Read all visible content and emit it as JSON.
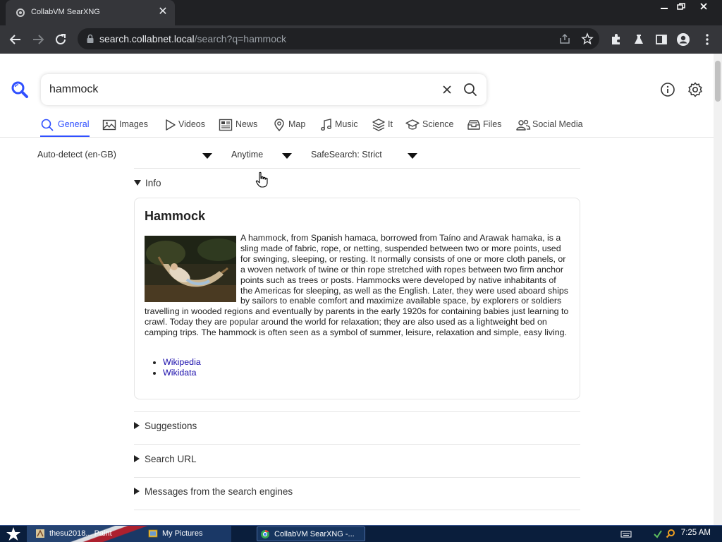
{
  "browser": {
    "tab_title": "CollabVM SearXNG",
    "url_host": "search.collabnet.local",
    "url_path": "/search?q=hammock"
  },
  "search": {
    "query": "hammock"
  },
  "categories": [
    {
      "label": "General",
      "icon": "search-icon",
      "active": true
    },
    {
      "label": "Images",
      "icon": "image-icon"
    },
    {
      "label": "Videos",
      "icon": "play-icon"
    },
    {
      "label": "News",
      "icon": "newspaper-icon"
    },
    {
      "label": "Map",
      "icon": "map-pin-icon"
    },
    {
      "label": "Music",
      "icon": "music-note-icon"
    },
    {
      "label": "It",
      "icon": "layers-icon"
    },
    {
      "label": "Science",
      "icon": "graduation-cap-icon"
    },
    {
      "label": "Files",
      "icon": "file-tray-icon"
    },
    {
      "label": "Social Media",
      "icon": "people-icon"
    }
  ],
  "filters": {
    "language": "Auto-detect (en-GB)",
    "time_range": "Anytime",
    "safesearch": "SafeSearch: Strict"
  },
  "sections": {
    "info": "Info",
    "suggestions": "Suggestions",
    "search_url": "Search URL",
    "engine_messages": "Messages from the search engines"
  },
  "infobox": {
    "title": "Hammock",
    "description": "A hammock, from Spanish hamaca, borrowed from Taíno and Arawak hamaka, is a sling made of fabric, rope, or netting, suspended between two or more points, used for swinging, sleeping, or resting. It normally consists of one or more cloth panels, or a woven network of twine or thin rope stretched with ropes between two firm anchor points such as trees or posts. Hammocks were developed by native inhabitants of the Americas for sleeping, as well as the English. Later, they were used aboard ships by sailors to enable comfort and maximize available space, by explorers or soldiers travelling in wooded regions and eventually by parents in the early 1920s for containing babies just learning to crawl. Today they are popular around the world for relaxation; they are also used as a lightweight bed on camping trips. The hammock is often seen as a symbol of summer, leisure, relaxation and simple, easy living.",
    "links": [
      "Wikipedia",
      "Wikidata"
    ]
  },
  "taskbar": {
    "tasks": [
      "thesu2018... Paint",
      "My Pictures",
      "CollabVM SearXNG -..."
    ],
    "clock": "7:25 AM"
  },
  "colors": {
    "accent": "#3050ff",
    "link": "#1a0dab",
    "chrome_dark": "#202124",
    "chrome_toolbar": "#35363a"
  }
}
